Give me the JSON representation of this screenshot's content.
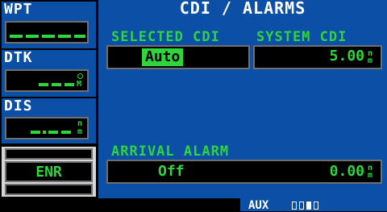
{
  "left_panel": {
    "wpt": {
      "label": "WPT"
    },
    "dtk": {
      "label": "DTK",
      "unit": "M"
    },
    "dis": {
      "label": "DIS",
      "unit_top": "n",
      "unit_bottom": "m"
    },
    "mode": {
      "label": "ENR"
    }
  },
  "page": {
    "title": "CDI / ALARMS",
    "selected_cdi": {
      "label": "SELECTED CDI",
      "value": "Auto"
    },
    "system_cdi": {
      "label": "SYSTEM CDI",
      "value": "5.00",
      "unit_top": "n",
      "unit_bottom": "m"
    },
    "arrival_alarm": {
      "label": "ARRIVAL ALARM",
      "state": "Off",
      "value": "0.00",
      "unit_top": "n",
      "unit_bottom": "m"
    }
  },
  "page_group": {
    "label": "AUX",
    "pages": 4,
    "active_page": 3
  },
  "colors": {
    "background": "#0b4fa6",
    "text_green": "#2fd53c",
    "text_white": "#ffffff",
    "field_bg": "#000000",
    "panel_gray": "#d6d6d6"
  }
}
